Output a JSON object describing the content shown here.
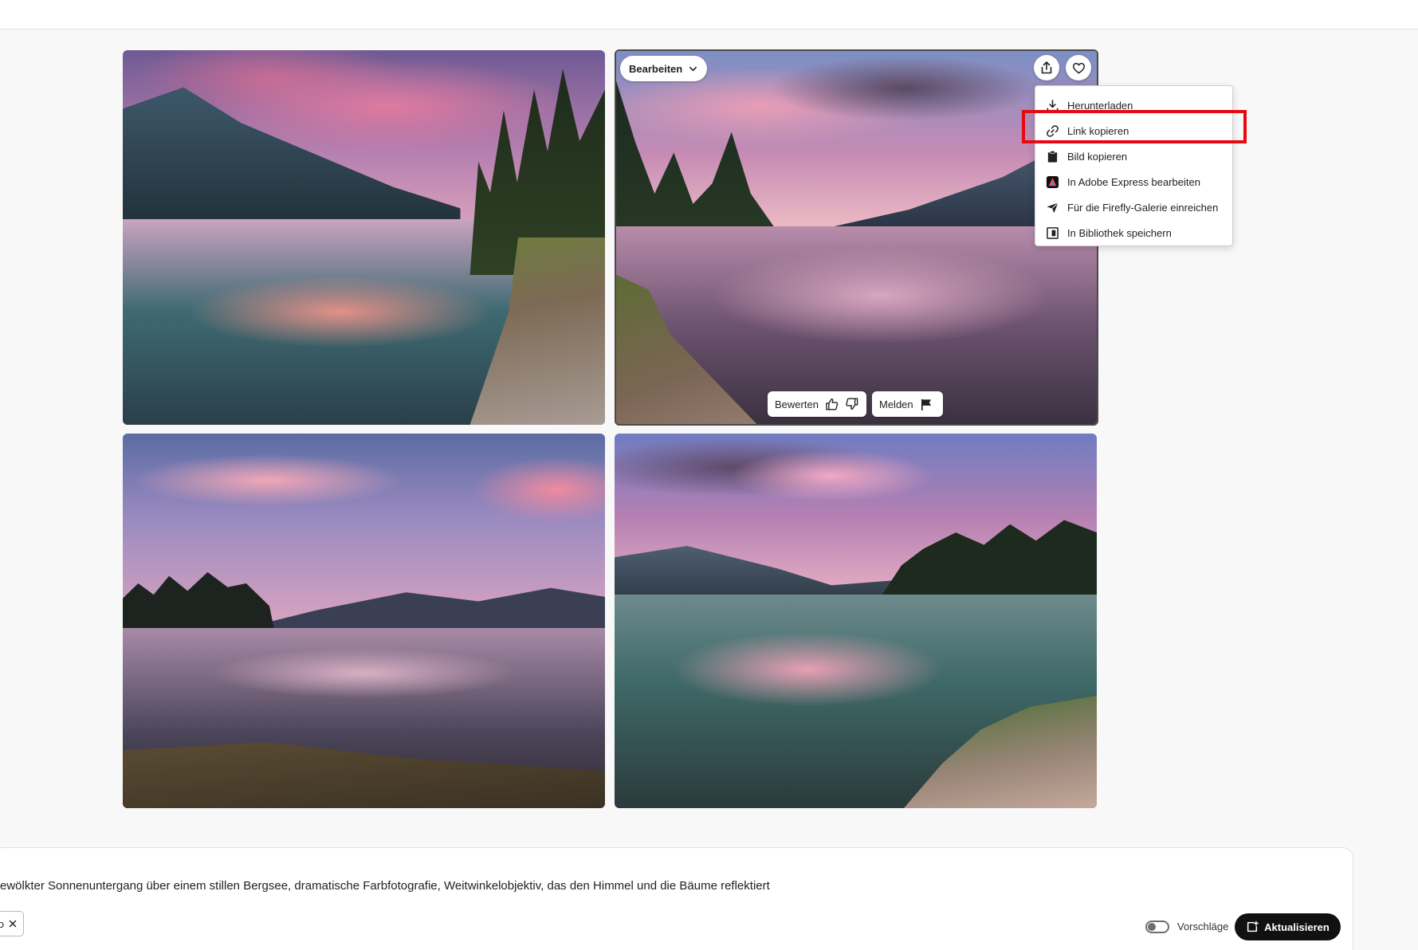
{
  "gallery": {
    "edit_label": "Bearbeiten",
    "rate_label": "Bewerten",
    "report_label": "Melden"
  },
  "menu": {
    "items": [
      {
        "label": "Herunterladen",
        "icon": "download-icon"
      },
      {
        "label": "Link kopieren",
        "icon": "link-icon"
      },
      {
        "label": "Bild kopieren",
        "icon": "clipboard-icon"
      },
      {
        "label": "In Adobe Express bearbeiten",
        "icon": "adobe-express-icon"
      },
      {
        "label": "Für die Firefly-Galerie einreichen",
        "icon": "send-icon"
      },
      {
        "label": "In Bibliothek speichern",
        "icon": "library-icon"
      }
    ],
    "highlighted": "Link kopieren",
    "highlight_color": "#e8080f"
  },
  "prompt": {
    "text": "ewölkter Sonnenuntergang über einem stillen Bergsee, dramatische Farbfotografie, Weitwinkelobjektiv, das den Himmel und die Bäume reflektiert",
    "tag_text": "o",
    "suggestions_label": "Vorschläge",
    "update_label": "Aktualisieren"
  }
}
